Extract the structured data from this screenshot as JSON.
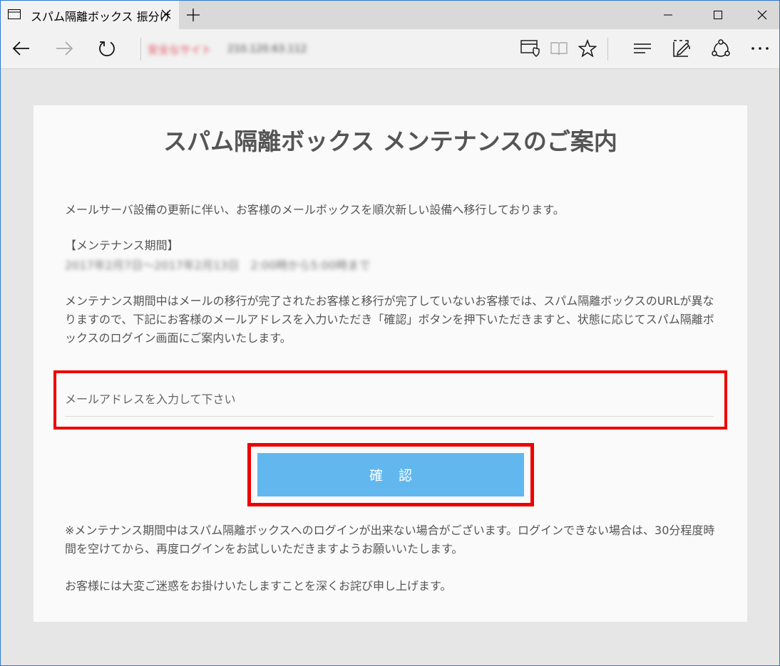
{
  "browser": {
    "tab_title": "スパム隔離ボックス 振分け",
    "address_site": "安全なサイト",
    "address_url": "210.120.63.112"
  },
  "content": {
    "title": "スパム隔離ボックス メンテナンスのご案内",
    "intro": "メールサーバ設備の更新に伴い、お客様のメールボックスを順次新しい設備へ移行しております。",
    "period_label": "【メンテナンス期間】",
    "period_value": "2017年2月7日～2017年2月13日　2:00時から5:00時まで",
    "notice": "メンテナンス期間中はメールの移行が完了されたお客様と移行が完了していないお客様では、スパム隔離ボックスのURLが異なりますので、下記にお客様のメールアドレスを入力いただき「確認」ボタンを押下いただきますと、状態に応じてスパム隔離ボックスのログイン画面にご案内いたします。",
    "email_placeholder": "メールアドレスを入力して下さい",
    "confirm_label": "確認",
    "note": "※メンテナンス期間中はスパム隔離ボックスへのログインが出来ない場合がございます。ログインできない場合は、30分程度時間を空けてから、再度ログインをお試しいただきますようお願いいたします。",
    "apology": "お客様には大変ご迷惑をお掛けいたしますことを深くお詫び申し上げます。"
  },
  "colors": {
    "accent_button": "#62b7ee",
    "highlight_border": "#ee0000",
    "window_border": "#2b79d4"
  }
}
